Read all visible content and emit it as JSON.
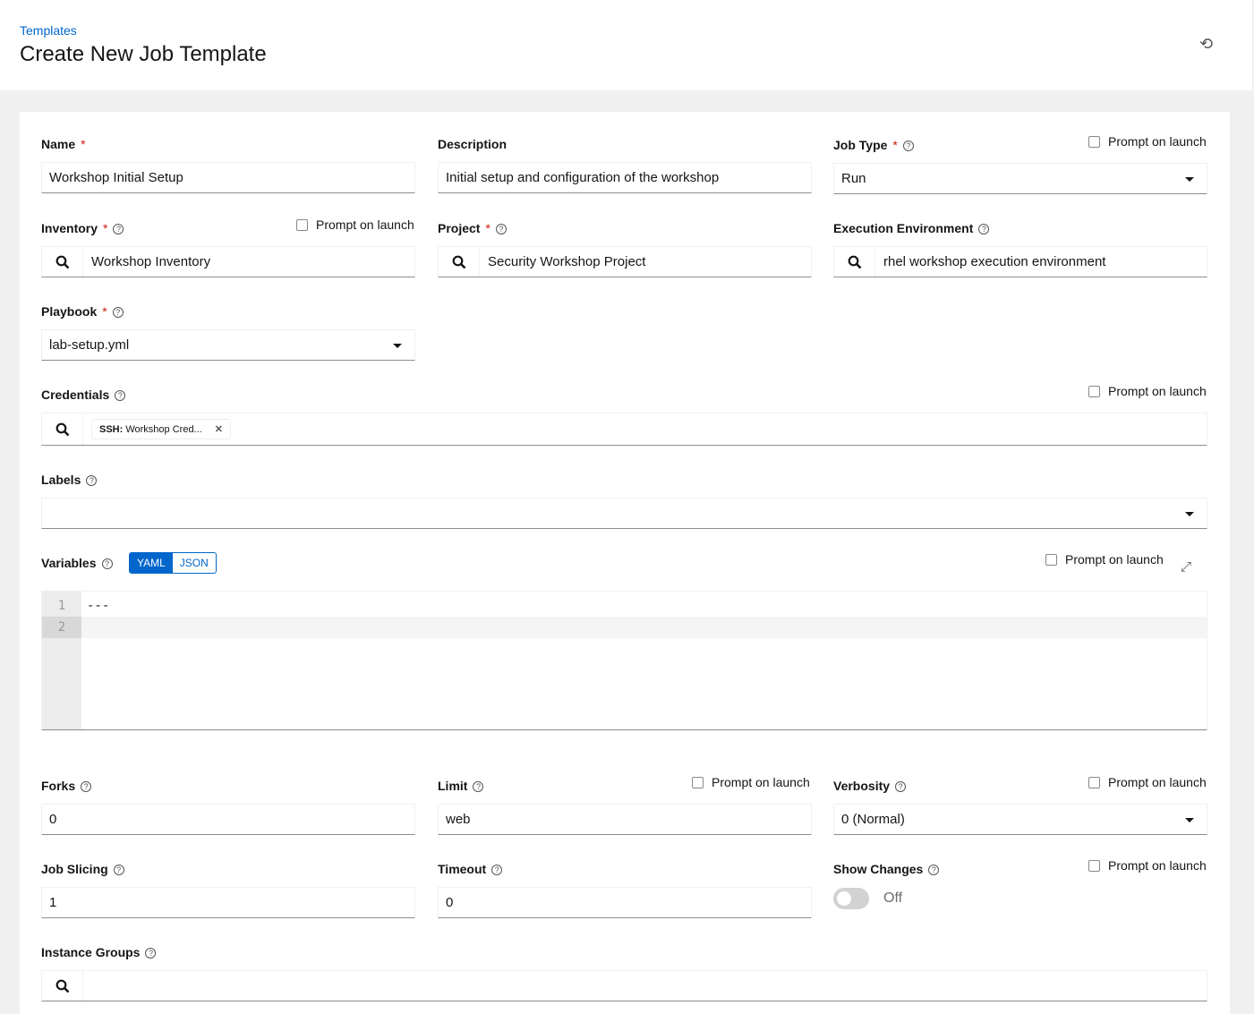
{
  "header": {
    "breadcrumb": "Templates",
    "title": "Create New Job Template",
    "history_icon": "history-icon"
  },
  "prompt": "Prompt on launch",
  "fields": {
    "name": {
      "label": "Name",
      "value": "Workshop Initial Setup"
    },
    "description": {
      "label": "Description",
      "value": "Initial setup and configuration of the workshop"
    },
    "job_type": {
      "label": "Job Type",
      "value": "Run"
    },
    "inventory": {
      "label": "Inventory",
      "value": "Workshop Inventory"
    },
    "project": {
      "label": "Project",
      "value": "Security Workshop Project"
    },
    "ee": {
      "label": "Execution Environment",
      "value": "rhel workshop execution environment"
    },
    "playbook": {
      "label": "Playbook",
      "value": "lab-setup.yml"
    },
    "credentials": {
      "label": "Credentials",
      "chip_type": "SSH:",
      "chip_name": "Workshop Cred..."
    },
    "labels": {
      "label": "Labels"
    },
    "variables": {
      "label": "Variables",
      "modes": [
        "YAML",
        "JSON"
      ],
      "active_mode": "YAML",
      "lines": [
        "---",
        ""
      ],
      "line_numbers": [
        "1",
        "2"
      ]
    },
    "forks": {
      "label": "Forks",
      "value": "0"
    },
    "limit": {
      "label": "Limit",
      "value": "web"
    },
    "verbosity": {
      "label": "Verbosity",
      "value": "0 (Normal)"
    },
    "job_slicing": {
      "label": "Job Slicing",
      "value": "1"
    },
    "timeout": {
      "label": "Timeout",
      "value": "0"
    },
    "show_changes": {
      "label": "Show Changes",
      "state": "Off"
    },
    "instance_groups": {
      "label": "Instance Groups"
    }
  },
  "colors": {
    "accent": "#0066cc",
    "required": "#c9190b"
  }
}
